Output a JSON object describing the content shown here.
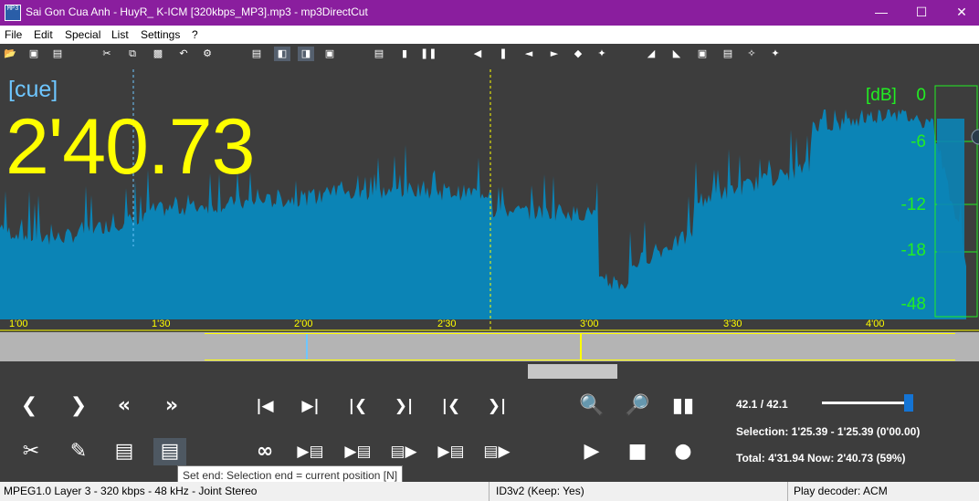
{
  "window": {
    "title": "Sai Gon Cua Anh - HuyR_ K-ICM [320kbps_MP3].mp3 - mp3DirectCut",
    "app_icon_text": "MP3",
    "minimize_icon": "minimize-icon",
    "maximize_icon": "maximize-icon",
    "close_icon": "close-icon"
  },
  "menu": [
    "File",
    "Edit",
    "Special",
    "List",
    "Settings",
    "?"
  ],
  "display": {
    "cue_label": "[cue]",
    "position_time": "2'40.73",
    "db_label": "[dB]",
    "db_ticks": [
      "0",
      "-6",
      "-12",
      "-18",
      "-48"
    ],
    "time_ticks": [
      "1'00",
      "1'30",
      "2'00",
      "2'30",
      "3'00",
      "3'30",
      "4'00"
    ]
  },
  "info": {
    "zoom_readout": "42.1  /  42.1",
    "volume_level": 0.95,
    "selection": "Selection: 1'25.39 - 1'25.39 (0'00.00)",
    "total_now": "Total: 4'31.94   Now: 2'40.73   (59%)"
  },
  "tooltip": "Set end: Selection end = current position   [N]",
  "status": {
    "format": "MPEG1.0 Layer 3 - 320 kbps - 48 kHz - Joint Stereo",
    "id3": "ID3v2 (Keep: Yes)",
    "decoder": "Play decoder: ACM"
  },
  "colors": {
    "title_bar": "#8a1e9e",
    "waveform": "#0b84b6",
    "time_text": "#ffff00",
    "cue_text": "#6ec6ff",
    "db_scale": "#22ee22",
    "background": "#3d3d3d"
  }
}
